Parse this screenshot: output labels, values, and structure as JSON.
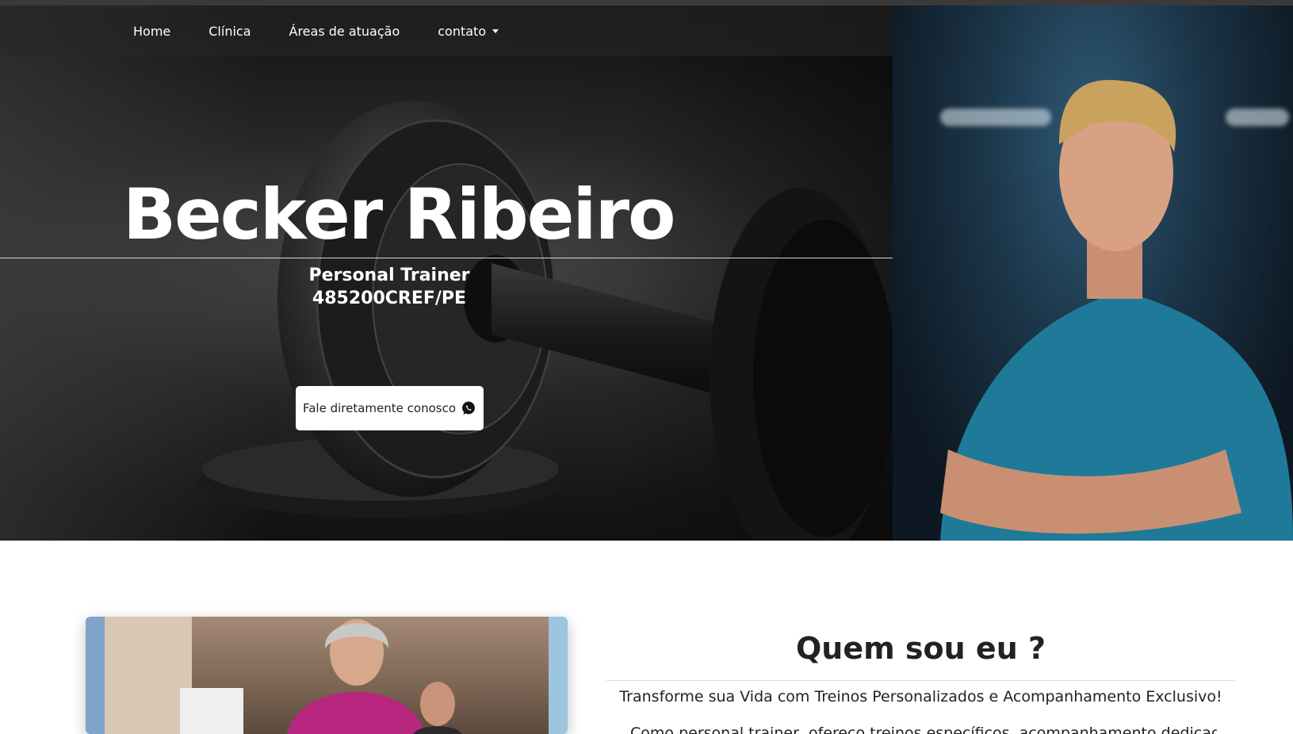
{
  "nav": {
    "items": [
      {
        "label": "Home"
      },
      {
        "label": "Clínica"
      },
      {
        "label": "Áreas de atuação"
      },
      {
        "label": "contato",
        "has_dropdown": true
      }
    ]
  },
  "hero": {
    "name": "Becker Ribeiro",
    "role": "Personal Trainer",
    "registration": "485200CREF/PE",
    "cta_label": "Fale diretamente conosco",
    "cta_icon": "whatsapp-icon"
  },
  "about": {
    "title": "Quem sou eu ?",
    "lead": "Transforme sua Vida com Treinos Personalizados e Acompanhamento Exclusivo!",
    "text": "Como personal trainer, ofereço treinos específicos, acompanhamento dedicado e"
  },
  "colors": {
    "hero_bg": "#141414",
    "cta_bg": "#ffffff",
    "photo_shirt": "#1f7a99"
  }
}
